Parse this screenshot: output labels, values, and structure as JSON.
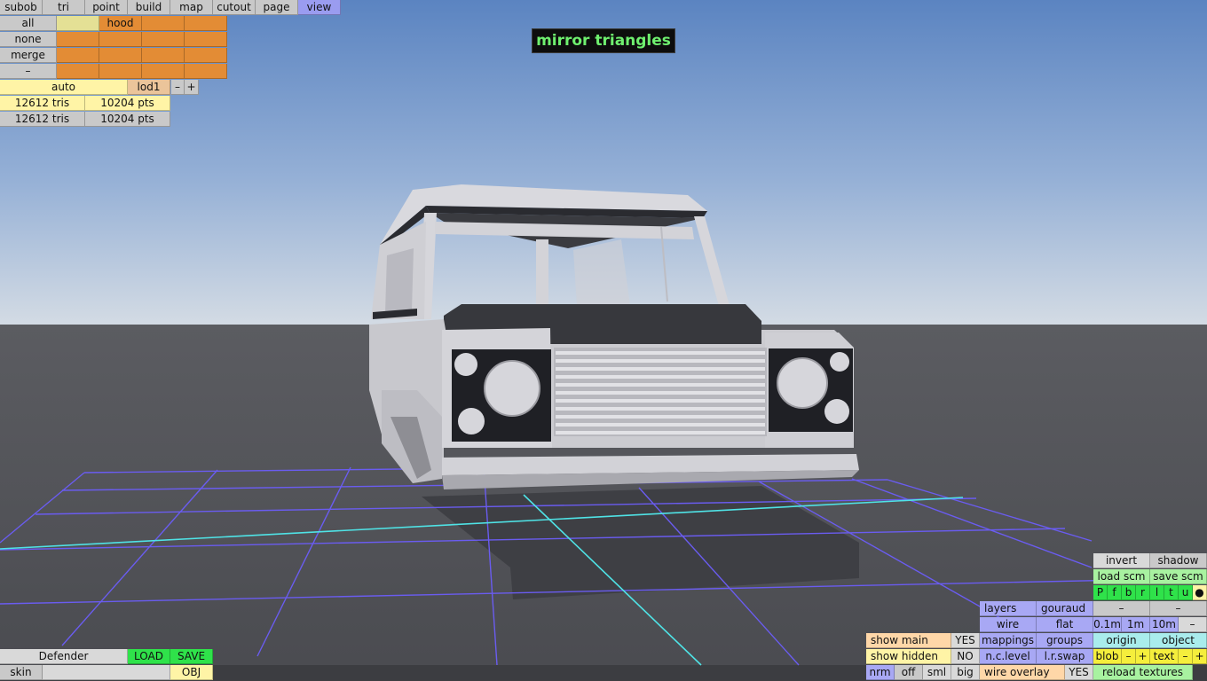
{
  "overlay": {
    "mode_label": "mirror triangles"
  },
  "menu": {
    "subob": "subob",
    "tri": "tri",
    "point": "point",
    "build": "build",
    "map": "map",
    "cutout": "cutout",
    "page": "page",
    "view": "view"
  },
  "selection": {
    "all": "all",
    "none": "none",
    "merge": "merge",
    "minus": "–",
    "group_hood": "hood"
  },
  "lod": {
    "auto": "auto",
    "current": "lod1",
    "minus": "–",
    "plus": "+"
  },
  "stats": {
    "row1_tris": "12612 tris",
    "row1_pts": "10204 pts",
    "row2_tris": "12612 tris",
    "row2_pts": "10204 pts"
  },
  "file": {
    "name": "Defender",
    "load": "LOAD",
    "save": "SAVE",
    "skin": "skin",
    "format": "OBJ"
  },
  "display": {
    "show_main": "show main",
    "show_main_value": "YES",
    "show_hidden": "show hidden",
    "show_hidden_value": "NO",
    "nrm": "nrm",
    "off": "off",
    "sml": "sml",
    "big": "big",
    "layers": "layers",
    "gouraud": "gouraud",
    "wire": "wire",
    "flat": "flat",
    "mappings": "mappings",
    "groups": "groups",
    "nc_level": "n.c.level",
    "lr_swap": "l.r.swap",
    "wire_overlay": "wire overlay",
    "wire_overlay_value": "YES"
  },
  "rightpanel": {
    "invert": "invert",
    "shadow": "shadow",
    "load_scm": "load scm",
    "save_scm": "save scm",
    "flags": [
      "P",
      "f",
      "b",
      "r",
      "l",
      "t",
      "u",
      "●"
    ],
    "dash1": "–",
    "dash2": "–",
    "grid_01": "0.1m",
    "grid_1": "1m",
    "grid_10": "10m",
    "grid_minus": "–",
    "origin": "origin",
    "object": "object",
    "blob": "blob",
    "blob_minus": "–",
    "blob_plus": "+",
    "text": "text",
    "text_minus": "–",
    "text_plus": "+",
    "reload_textures": "reload textures"
  },
  "colors": {
    "sky_top": "#5d86c2",
    "sky_horizon": "#cdd7e2",
    "ground": "#535459",
    "grid_line": "#6b5cf0",
    "axis_line": "#4fe3e6",
    "body": "#d0d0d5",
    "panel": "#2a2a2e",
    "mode_text": "#6ff06f"
  }
}
